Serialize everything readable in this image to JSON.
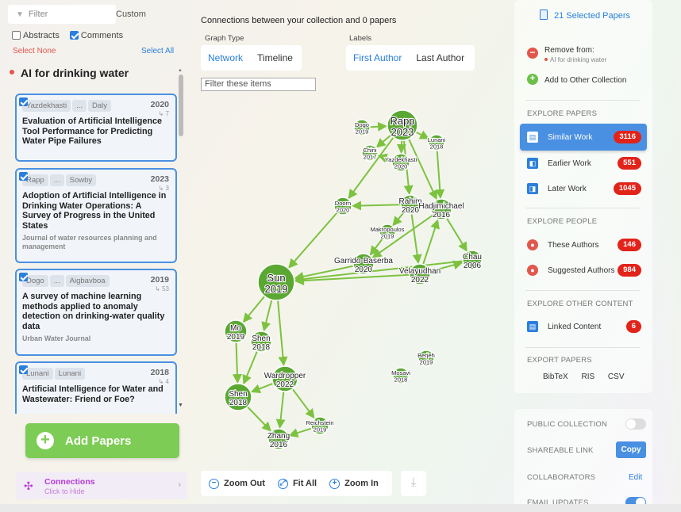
{
  "left": {
    "filter_placeholder": "Filter",
    "custom_label": "Custom",
    "abstracts_label": "Abstracts",
    "comments_label": "Comments",
    "select_none": "Select None",
    "select_all": "Select All",
    "collection_title": "AI for drinking water",
    "papers": [
      {
        "authors": [
          "Yazdekhasti",
          "...",
          "Daly"
        ],
        "year": "2020",
        "cites": "↳ 7",
        "title": "Evaluation of Artificial Intelligence Tool Performance for Predicting Water Pipe Failures",
        "journal": ""
      },
      {
        "authors": [
          "Rapp",
          "...",
          "Sowby"
        ],
        "year": "2023",
        "cites": "↳ 3",
        "title": "Adoption of Artificial Intelligence in Drinking Water Operations: A Survey of Progress in the United States",
        "journal": "Journal of water resources planning and management"
      },
      {
        "authors": [
          "Dogo",
          "...",
          "Aigbavboa"
        ],
        "year": "2019",
        "cites": "↳ 53",
        "title": "A survey of machine learning methods applied to anomaly detection on drinking-water quality data",
        "journal": "Urban Water Journal"
      },
      {
        "authors": [
          "Lunani",
          "Lunani"
        ],
        "year": "2018",
        "cites": "↳ 4",
        "title": "Artificial Intelligence for Water and Wastewater: Friend or Foe?",
        "journal": ""
      }
    ],
    "add_papers": "Add Papers",
    "connections_label": "Connections",
    "connections_sub": "Click to Hide"
  },
  "center": {
    "header": "Connections between your collection and 0 papers",
    "graph_type_label": "Graph Type",
    "graph_types": [
      "Network",
      "Timeline"
    ],
    "labels_label": "Labels",
    "label_types": [
      "First Author",
      "Last Author"
    ],
    "filter_items_placeholder": "Filter these items",
    "zoom_out": "Zoom Out",
    "fit_all": "Fit All",
    "zoom_in": "Zoom In",
    "nodes": [
      {
        "id": "rapp",
        "name": "Rapp",
        "year": "2023"
      },
      {
        "id": "dogo",
        "name": "Dogo",
        "year": "2019"
      },
      {
        "id": "chini",
        "name": "Chini",
        "year": "2017"
      },
      {
        "id": "yazdekhasti",
        "name": "Yazdekhasti",
        "year": "2020"
      },
      {
        "id": "lunani",
        "name": "Lunani",
        "year": "2018"
      },
      {
        "id": "doorn",
        "name": "Doorn",
        "year": "2020"
      },
      {
        "id": "rahim",
        "name": "Rahim",
        "year": "2020"
      },
      {
        "id": "hadjimichael",
        "name": "Hadjimichael",
        "year": "2016"
      },
      {
        "id": "makropoulos",
        "name": "Makropoulos",
        "year": "2019"
      },
      {
        "id": "garrido",
        "name": "Garrido-Baserba",
        "year": "2020"
      },
      {
        "id": "velayudhan",
        "name": "Velayudhan",
        "year": "2022"
      },
      {
        "id": "chau",
        "name": "Chau",
        "year": "2006"
      },
      {
        "id": "sun",
        "name": "Sun",
        "year": "2019"
      },
      {
        "id": "mo",
        "name": "Mo",
        "year": "2019"
      },
      {
        "id": "shen2018a",
        "name": "Shen",
        "year": "2018"
      },
      {
        "id": "wardropper",
        "name": "Wardropper",
        "year": "2022"
      },
      {
        "id": "shen2018b",
        "name": "Shen",
        "year": "2018"
      },
      {
        "id": "reichstein",
        "name": "Reichstein",
        "year": "2019"
      },
      {
        "id": "zhang",
        "name": "Zhang",
        "year": "2016"
      },
      {
        "id": "berjeh",
        "name": "Berjeh",
        "year": "2019"
      },
      {
        "id": "mosavi",
        "name": "Mosavi",
        "year": "2018"
      }
    ]
  },
  "right": {
    "selected_papers": "21 Selected Papers",
    "remove_from": "Remove from:",
    "remove_collection": "AI for drinking water",
    "add_to_other": "Add to Other Collection",
    "explore_papers": "EXPLORE PAPERS",
    "similar_work": "Similar Work",
    "similar_count": "3116",
    "earlier_work": "Earlier Work",
    "earlier_count": "551",
    "later_work": "Later Work",
    "later_count": "1045",
    "explore_people": "EXPLORE PEOPLE",
    "these_authors": "These Authors",
    "these_count": "146",
    "suggested_authors": "Suggested Authors",
    "suggested_count": "984",
    "explore_other": "EXPLORE OTHER CONTENT",
    "linked_content": "Linked Content",
    "linked_count": "6",
    "export_papers": "EXPORT PAPERS",
    "export_formats": [
      "BibTeX",
      "RIS",
      "CSV"
    ],
    "public_collection": "PUBLIC COLLECTION",
    "shareable_link": "SHAREABLE LINK",
    "copy": "Copy",
    "collaborators": "COLLABORATORS",
    "edit": "Edit",
    "email_updates": "EMAIL UPDATES"
  },
  "colors": {
    "accent": "#2b7fdc",
    "node_green": "#5aa832",
    "edge_green": "#7cc23f",
    "add_green": "#7dcc55",
    "badge_red": "#e2231a"
  }
}
